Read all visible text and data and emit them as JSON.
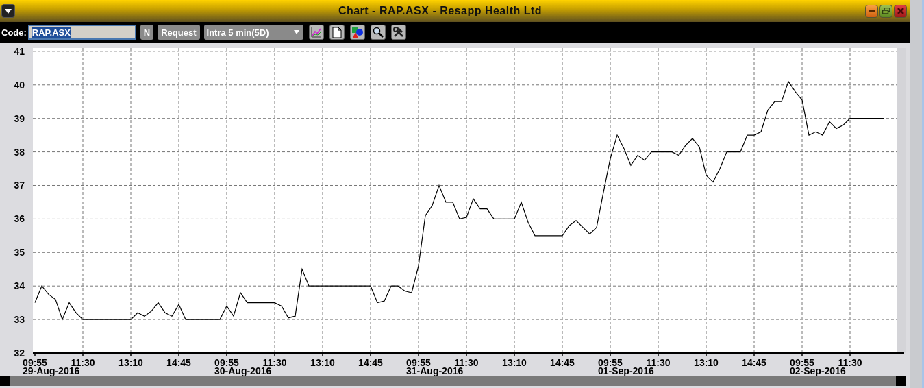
{
  "window": {
    "title": "Chart - RAP.ASX - Resapp Health Ltd"
  },
  "toolbar": {
    "code_label": "Code:",
    "code_value": "RAP.ASX",
    "n_button": "N",
    "request_button": "Request",
    "interval": "Intra 5 min(5D)"
  },
  "chart": {
    "chart_data": {
      "type": "line",
      "categories": [
        "09:55",
        null,
        null,
        null,
        null,
        null,
        null,
        "11:30",
        null,
        null,
        null,
        null,
        null,
        null,
        "13:10",
        null,
        null,
        null,
        null,
        null,
        null,
        "14:45",
        null,
        null,
        null,
        null,
        null,
        null,
        "09:55",
        null,
        null,
        null,
        null,
        null,
        null,
        "11:30",
        null,
        null,
        null,
        null,
        null,
        null,
        "13:10",
        null,
        null,
        null,
        null,
        null,
        null,
        "14:45",
        null,
        null,
        null,
        null,
        null,
        null,
        "09:55",
        null,
        null,
        null,
        null,
        null,
        null,
        "11:30",
        null,
        null,
        null,
        null,
        null,
        null,
        "13:10",
        null,
        null,
        null,
        null,
        null,
        null,
        "14:45",
        null,
        null,
        null,
        null,
        null,
        null,
        "09:55",
        null,
        null,
        null,
        null,
        null,
        null,
        "11:30",
        null,
        null,
        null,
        null,
        null,
        null,
        "13:10",
        null,
        null,
        null,
        null,
        null,
        null,
        "14:45",
        null,
        null,
        null,
        null,
        null,
        null,
        "09:55",
        null,
        null,
        null,
        null,
        null,
        null,
        "11:30",
        null,
        null,
        null,
        null,
        null
      ],
      "series": [
        {
          "color": "#000000",
          "values": [
            33.5,
            34,
            33.75,
            33.6,
            33,
            33.5,
            33.2,
            33,
            33,
            33,
            33,
            33,
            33,
            33,
            33,
            33.2,
            33.1,
            33.25,
            33.5,
            33.2,
            33.1,
            33.45,
            33,
            33,
            33,
            33,
            33,
            33,
            33.4,
            33.1,
            33.8,
            33.5,
            33.5,
            33.5,
            33.5,
            33.5,
            33.4,
            33.05,
            33.1,
            34.5,
            34,
            34,
            34,
            34,
            34,
            34,
            34,
            34,
            34,
            34,
            33.5,
            33.55,
            34,
            34,
            33.85,
            33.8,
            34.6,
            36.1,
            36.4,
            37,
            36.5,
            36.5,
            36,
            36.05,
            36.6,
            36.3,
            36.3,
            36,
            36,
            36,
            36,
            36.5,
            35.9,
            35.5,
            35.5,
            35.5,
            35.5,
            35.5,
            35.8,
            35.95,
            35.75,
            35.55,
            35.75,
            36.8,
            37.8,
            38.5,
            38.1,
            37.6,
            37.9,
            37.75,
            38,
            38,
            38,
            38,
            37.9,
            38.2,
            38.4,
            38.15,
            37.3,
            37.1,
            37.5,
            38,
            38,
            38,
            38.5,
            38.5,
            38.6,
            39.25,
            39.5,
            39.5,
            40.1,
            39.8,
            39.55,
            38.5,
            38.6,
            38.5,
            38.9,
            38.7,
            38.8,
            39,
            39,
            39,
            39,
            39,
            39
          ]
        }
      ],
      "grid": true,
      "ylim": [
        32,
        41.1
      ],
      "yticks": [
        32,
        33,
        34,
        35,
        36,
        37,
        38,
        39,
        40,
        41
      ],
      "annotations": [
        "29-Aug-2016",
        "30-Aug-2016",
        "31-Aug-2016",
        "01-Sep-2016",
        "02-Sep-2016"
      ]
    }
  }
}
